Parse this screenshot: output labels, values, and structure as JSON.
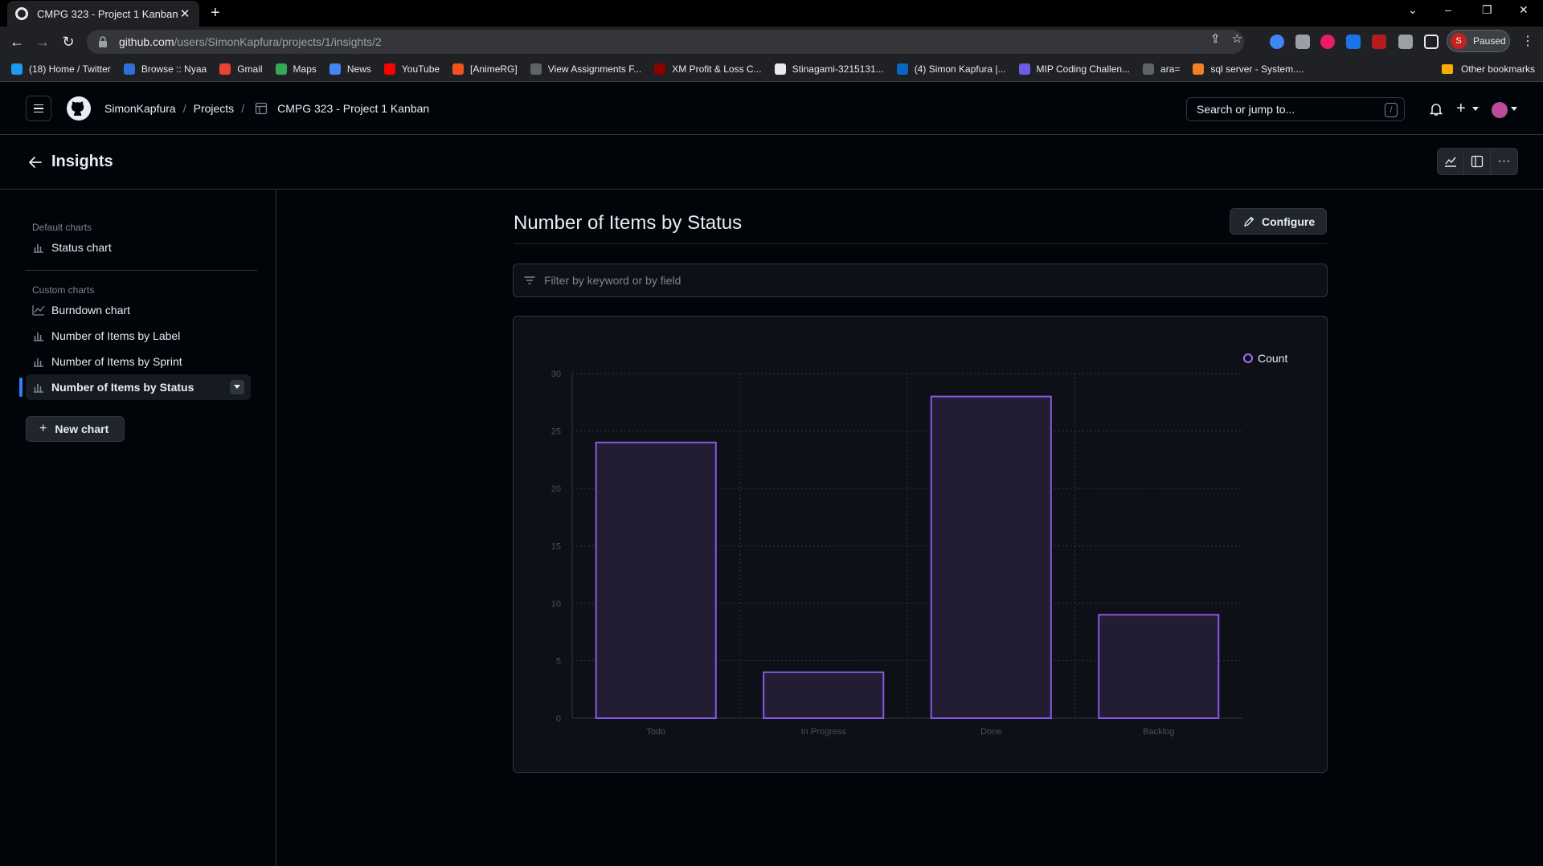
{
  "browser": {
    "tab_title": "CMPG 323 - Project 1 Kanban",
    "url_host": "github.com",
    "url_path": "/users/SimonKapfura/projects/1/insights/2",
    "profile_label": "Paused",
    "profile_initial": "S",
    "bookmarks": [
      {
        "label": "(18) Home / Twitter",
        "color": "#1d9bf0"
      },
      {
        "label": "Browse :: Nyaa",
        "color": "#2f6fd6"
      },
      {
        "label": "Gmail",
        "color": "#ea4335"
      },
      {
        "label": "Maps",
        "color": "#34a853"
      },
      {
        "label": "News",
        "color": "#4285f4"
      },
      {
        "label": "YouTube",
        "color": "#ff0000"
      },
      {
        "label": "[AnimeRG]",
        "color": "#f4511e"
      },
      {
        "label": "View Assignments F...",
        "color": "#5f6368"
      },
      {
        "label": "XM Profit & Loss C...",
        "color": "#8b0000"
      },
      {
        "label": "Stinagami-3215131...",
        "color": "#e8eaed"
      },
      {
        "label": "(4) Simon Kapfura |...",
        "color": "#0a66c2"
      },
      {
        "label": "MIP Coding Challen...",
        "color": "#6c5ce7"
      },
      {
        "label": "ara=",
        "color": "#5f6368"
      },
      {
        "label": "sql server - System....",
        "color": "#f48024"
      }
    ],
    "other_bookmarks": "Other bookmarks"
  },
  "header": {
    "owner": "SimonKapfura",
    "projects": "Projects",
    "project_name": "CMPG 323 - Project 1 Kanban",
    "search_placeholder": "Search or jump to...",
    "search_key": "/"
  },
  "insights": {
    "title": "Insights"
  },
  "sidebar": {
    "default_heading": "Default charts",
    "default_items": [
      {
        "label": "Status chart"
      }
    ],
    "custom_heading": "Custom charts",
    "custom_items": [
      {
        "label": "Burndown chart",
        "icon": "graph-line-icon"
      },
      {
        "label": "Number of Items by Label",
        "icon": "bar-chart-icon"
      },
      {
        "label": "Number of Items by Sprint",
        "icon": "bar-chart-icon"
      },
      {
        "label": "Number of Items by Status",
        "icon": "bar-chart-icon",
        "active": true
      }
    ],
    "new_chart": "New chart"
  },
  "main": {
    "title": "Number of Items by Status",
    "configure_label": "Configure",
    "filter_placeholder": "Filter by keyword or by field"
  },
  "chart_data": {
    "type": "bar",
    "categories": [
      "Todo",
      "In Progress",
      "Done",
      "Backlog"
    ],
    "series": [
      {
        "name": "Count",
        "values": [
          24,
          4,
          28,
          9
        ]
      }
    ],
    "ylim": [
      0,
      30
    ],
    "yticks": [
      0,
      5,
      10,
      15,
      20,
      25,
      30
    ],
    "grid": true,
    "legend": "top-right",
    "bar_fill": "#221d33",
    "bar_stroke": "#8957e5"
  }
}
